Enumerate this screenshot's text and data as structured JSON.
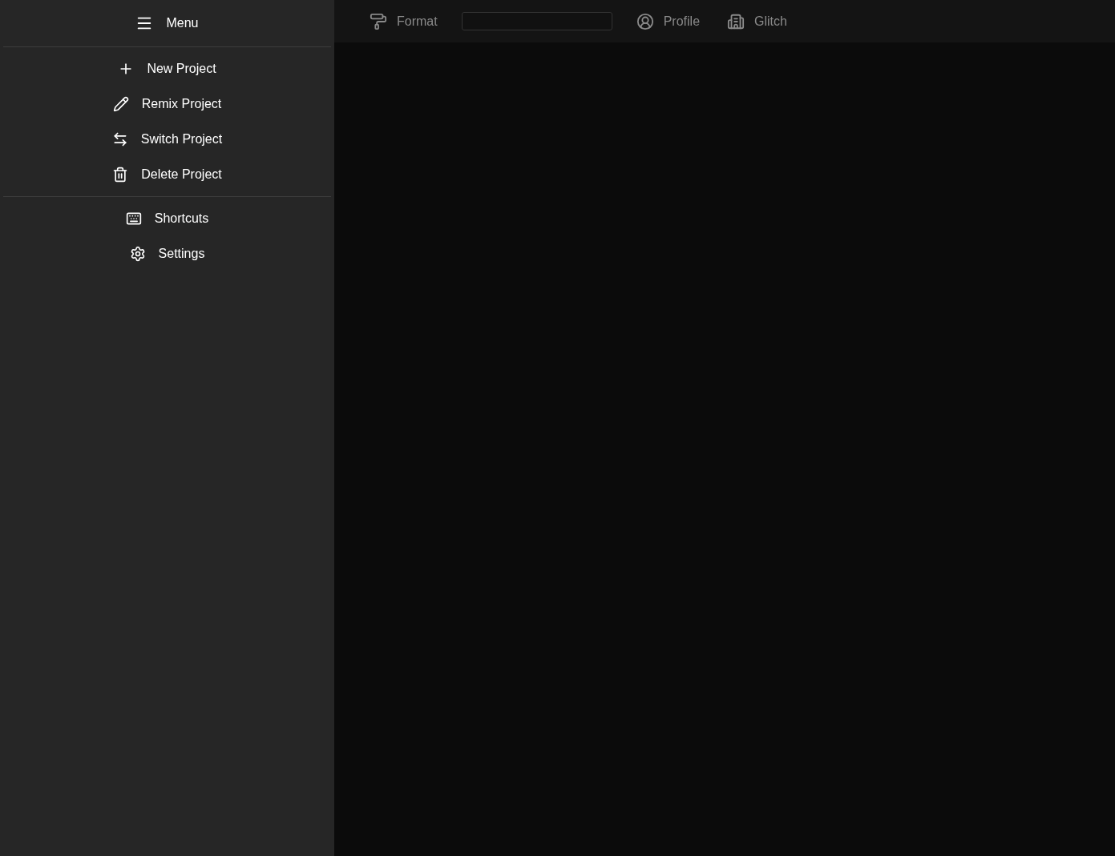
{
  "drawer": {
    "title": "Menu",
    "sections": [
      [
        {
          "label": "New Project",
          "kind": "plus"
        },
        {
          "label": "Remix Project",
          "kind": "pencil"
        },
        {
          "label": "Switch Project",
          "kind": "swap"
        },
        {
          "label": "Delete Project",
          "kind": "trash"
        }
      ],
      [
        {
          "label": "Shortcuts",
          "kind": "keyboard"
        },
        {
          "label": "Settings",
          "kind": "gear"
        }
      ]
    ]
  },
  "toolbar": {
    "items": [
      {
        "kind": "format",
        "label": "Format"
      },
      {
        "kind": "field"
      },
      {
        "kind": "profile",
        "label": "Profile"
      },
      {
        "kind": "glitch",
        "label": "Glitch"
      }
    ]
  }
}
